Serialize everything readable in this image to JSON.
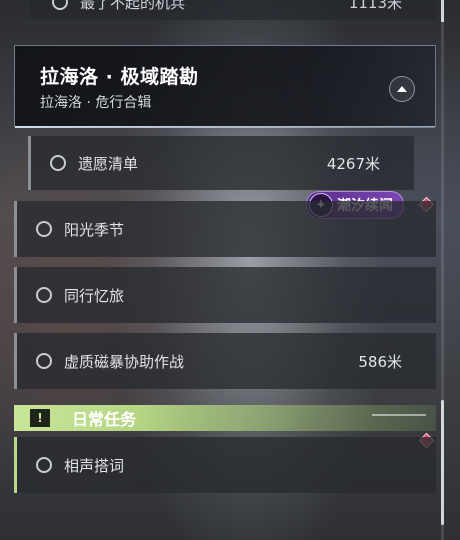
{
  "top_row": {
    "label": "最了不起的机兵",
    "distance": "1113米"
  },
  "quest": {
    "title": "拉海洛 · 极域踏勘",
    "subtitle": "拉海洛 · 危行合辑"
  },
  "subtasks": [
    {
      "label": "遗愿清单",
      "distance": "4267米"
    }
  ],
  "badge": {
    "text": "潮汐续闻",
    "color": "#7b45b5"
  },
  "tasks": [
    {
      "label": "阳光季节",
      "distance": ""
    },
    {
      "label": "同行忆旅",
      "distance": ""
    },
    {
      "label": "虚质磁暴协助作战",
      "distance": "586米"
    }
  ],
  "daily": {
    "title": "日常任务",
    "icon": "!",
    "tasks": [
      {
        "label": "相声搭词",
        "distance": ""
      }
    ],
    "accent": "#c9e59a"
  }
}
